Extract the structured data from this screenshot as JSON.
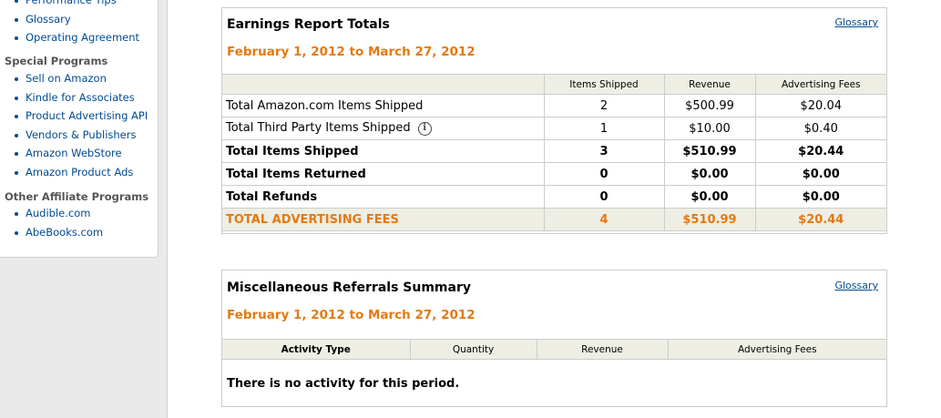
{
  "sidebar": {
    "top_items": [
      {
        "label": "Performance Tips"
      },
      {
        "label": "Glossary"
      },
      {
        "label": "Operating Agreement"
      }
    ],
    "special_heading": "Special Programs",
    "special_items": [
      {
        "label": "Sell on Amazon"
      },
      {
        "label": "Kindle for Associates"
      },
      {
        "label": "Product Advertising API"
      },
      {
        "label": "Vendors & Publishers"
      },
      {
        "label": "Amazon WebStore"
      },
      {
        "label": "Amazon Product Ads"
      }
    ],
    "other_heading": "Other Affiliate Programs",
    "other_items": [
      {
        "label": "Audible.com"
      },
      {
        "label": "AbeBooks.com"
      }
    ]
  },
  "earnings": {
    "title": "Earnings Report Totals",
    "glossary": "Glossary",
    "daterange": "February 1, 2012 to March 27, 2012",
    "columns": [
      "",
      "Items Shipped",
      "Revenue",
      "Advertising Fees"
    ],
    "rows": [
      {
        "label": "Total Amazon.com Items Shipped",
        "items": "2",
        "revenue": "$500.99",
        "fees": "$20.04"
      },
      {
        "label": "Total Third Party Items Shipped",
        "items": "1",
        "revenue": "$10.00",
        "fees": "$0.40"
      },
      {
        "label": "Total Items Shipped",
        "items": "3",
        "revenue": "$510.99",
        "fees": "$20.44"
      },
      {
        "label": "Total Items Returned",
        "items": "0",
        "revenue": "$0.00",
        "fees": "$0.00"
      },
      {
        "label": "Total Refunds",
        "items": "0",
        "revenue": "$0.00",
        "fees": "$0.00"
      },
      {
        "label": "TOTAL ADVERTISING FEES",
        "items": "4",
        "revenue": "$510.99",
        "fees": "$20.44"
      }
    ],
    "info_icon": "info-icon"
  },
  "misc": {
    "title": "Miscellaneous Referrals Summary",
    "glossary": "Glossary",
    "daterange": "February 1, 2012 to March 27, 2012",
    "columns": [
      "Activity Type",
      "Quantity",
      "Revenue",
      "Advertising Fees"
    ],
    "empty_message": "There is no activity for this period."
  },
  "colors": {
    "accent_orange": "#e47911",
    "link_blue": "#004b91",
    "header_bg": "#eeeee4"
  }
}
